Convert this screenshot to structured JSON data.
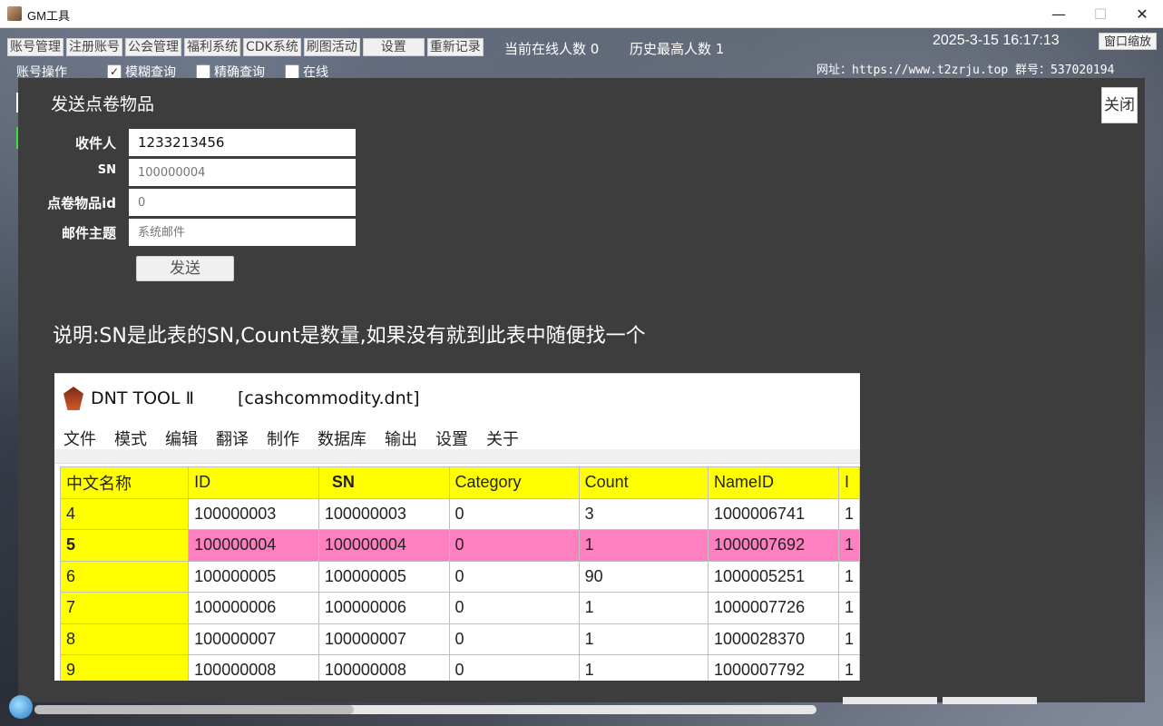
{
  "window": {
    "title": "GM工具",
    "min": "—",
    "max": "☐",
    "close": "✕"
  },
  "menu": [
    {
      "label": "账号管理"
    },
    {
      "label": "注册账号"
    },
    {
      "label": "公会管理"
    },
    {
      "label": "福利系统"
    },
    {
      "label": "CDK系统"
    },
    {
      "label": "刷图活动"
    },
    {
      "label": "设置"
    },
    {
      "label": "重新记录"
    }
  ],
  "status": {
    "online": "当前在线人数 0",
    "history": "历史最高人数 1",
    "clock": "2025-3-15 16:17:13",
    "zoom": "窗口缩放",
    "site": "网址：https://www.t2zrju.top 群号：537020194"
  },
  "account_ops": {
    "label": "账号操作",
    "checks": [
      {
        "label": "模糊查询",
        "checked": true
      },
      {
        "label": "精确查询",
        "checked": false
      },
      {
        "label": "在线",
        "checked": false
      }
    ]
  },
  "modal": {
    "title": "发送点卷物品",
    "close": "关闭",
    "fields": {
      "recipient_label": "收件人",
      "recipient_value": "1233213456",
      "sn_label": "SN",
      "sn_placeholder": "100000004",
      "item_label": "点卷物品id",
      "item_placeholder": "0",
      "subject_label": "邮件主题",
      "subject_placeholder": "系统邮件"
    },
    "send": "发送",
    "note": "说明:SN是此表的SN,Count是数量,如果没有就到此表中随便找一个"
  },
  "dnt": {
    "title": "DNT TOOL Ⅱ",
    "file": "[cashcommodity.dnt]",
    "menu": [
      "文件",
      "模式",
      "编辑",
      "翻译",
      "制作",
      "数据库",
      "输出",
      "设置",
      "关于"
    ],
    "headers": [
      "中文名称",
      "ID",
      "SN",
      "Category",
      "Count",
      "NameID",
      "I"
    ],
    "rows": [
      [
        "4",
        "100000003",
        "100000003",
        "0",
        "3",
        "1000006741",
        "1"
      ],
      [
        "5",
        "100000004",
        "100000004",
        "0",
        "1",
        "1000007692",
        "1"
      ],
      [
        "6",
        "100000005",
        "100000005",
        "0",
        "90",
        "1000005251",
        "1"
      ],
      [
        "7",
        "100000006",
        "100000006",
        "0",
        "1",
        "1000007726",
        "1"
      ],
      [
        "8",
        "100000007",
        "100000007",
        "0",
        "1",
        "1000028370",
        "1"
      ],
      [
        "9",
        "100000008",
        "100000008",
        "0",
        "1",
        "1000007792",
        "1"
      ]
    ],
    "selected_row": 1
  }
}
